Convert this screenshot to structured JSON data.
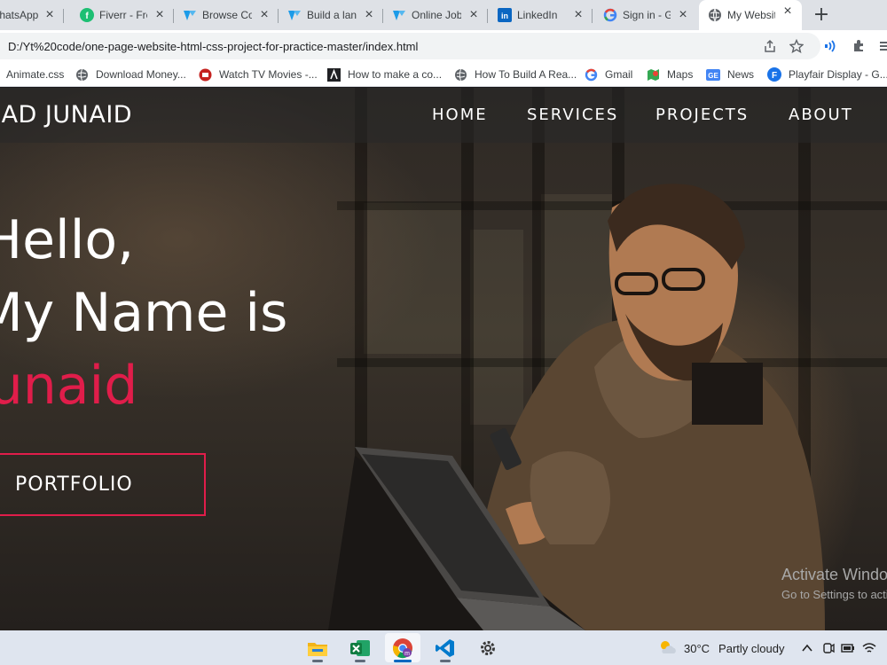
{
  "browser": {
    "tabs": [
      {
        "title": "WhatsApp",
        "icon": "whatsapp-icon"
      },
      {
        "title": "Fiverr - Fre",
        "icon": "fiverr-icon"
      },
      {
        "title": "Browse Co",
        "icon": "upwork-icon"
      },
      {
        "title": "Build a lan",
        "icon": "upwork-icon"
      },
      {
        "title": "Online Job",
        "icon": "upwork-icon"
      },
      {
        "title": "LinkedIn",
        "icon": "linkedin-icon"
      },
      {
        "title": "Sign in - G",
        "icon": "google-icon"
      },
      {
        "title": "My Websit",
        "icon": "globe-icon",
        "active": true
      }
    ],
    "url": "D:/Yt%20code/one-page-website-html-css-project-for-practice-master/index.html",
    "bookmarks": [
      {
        "label": "Animate.css",
        "icon": ""
      },
      {
        "label": "Download Money...",
        "icon": "globe-icon"
      },
      {
        "label": "Watch TV Movies -...",
        "icon": "tv-icon"
      },
      {
        "label": "How to make a co...",
        "icon": "arch-icon"
      },
      {
        "label": "How To Build A Rea...",
        "icon": "globe-icon"
      },
      {
        "label": "Gmail",
        "icon": "google-icon"
      },
      {
        "label": "Maps",
        "icon": "maps-icon"
      },
      {
        "label": "News",
        "icon": "news-icon"
      },
      {
        "label": "Playfair Display - G...",
        "icon": "fonts-icon"
      }
    ]
  },
  "site": {
    "logo": "MMAD JUNAID",
    "nav": [
      "HOME",
      "SERVICES",
      "PROJECTS",
      "ABOUT"
    ],
    "hero": {
      "line1": "Hello,",
      "line2": "My Name is",
      "name": "Junaid",
      "button": "PORTFOLIO"
    },
    "accent_color": "#e01d4a"
  },
  "watermark": {
    "title": "Activate Windows",
    "subtitle": "Go to Settings to activate Windows."
  },
  "taskbar": {
    "apps": [
      "file-explorer-icon",
      "excel-icon",
      "chrome-icon",
      "vscode-icon",
      "settings-icon"
    ],
    "active_app": "chrome-icon",
    "weather": {
      "temp": "30°C",
      "condition": "Partly cloudy"
    }
  }
}
